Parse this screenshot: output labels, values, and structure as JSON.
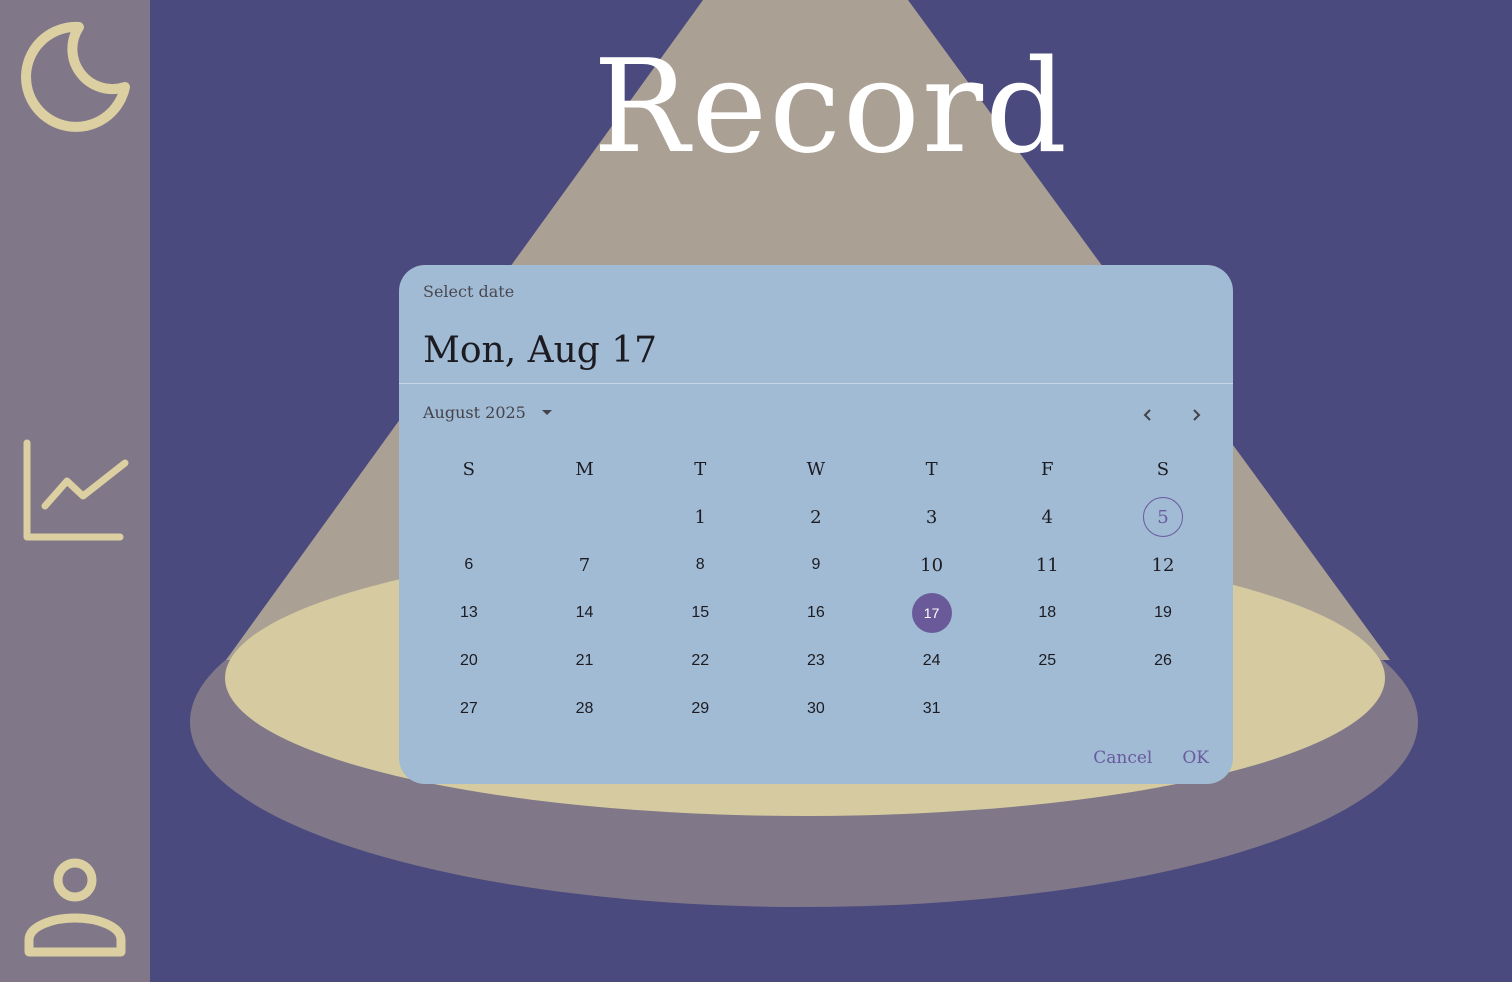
{
  "page": {
    "title": "Record"
  },
  "sidebar": {
    "items": [
      {
        "icon": "moon-icon"
      },
      {
        "icon": "chart-icon"
      },
      {
        "icon": "person-icon"
      }
    ]
  },
  "colors": {
    "background": "#4b4a7e",
    "sidebar": "#807888",
    "icon": "#dccfa2",
    "dialog": "#a0bbd3",
    "accent": "#6a5a9a",
    "spotlight": "#aaa094",
    "stage": "#d6cba0",
    "stage_shadow": "#807888"
  },
  "dialog": {
    "header_label": "Select date",
    "selected_date": "Mon, Aug 17",
    "month_label": "August 2025",
    "weekdays": [
      "S",
      "M",
      "T",
      "W",
      "T",
      "F",
      "S"
    ],
    "weeks": [
      [
        "",
        "",
        "1",
        "2",
        "3",
        "4",
        "5"
      ],
      [
        "6",
        "7",
        "8",
        "9",
        "10",
        "11",
        "12"
      ],
      [
        "13",
        "14",
        "15",
        "16",
        "17",
        "18",
        "19"
      ],
      [
        "20",
        "21",
        "22",
        "23",
        "24",
        "25",
        "26"
      ],
      [
        "27",
        "28",
        "29",
        "30",
        "31",
        "",
        ""
      ]
    ],
    "today": "5",
    "selected": "17",
    "cancel_label": "Cancel",
    "ok_label": "OK"
  }
}
